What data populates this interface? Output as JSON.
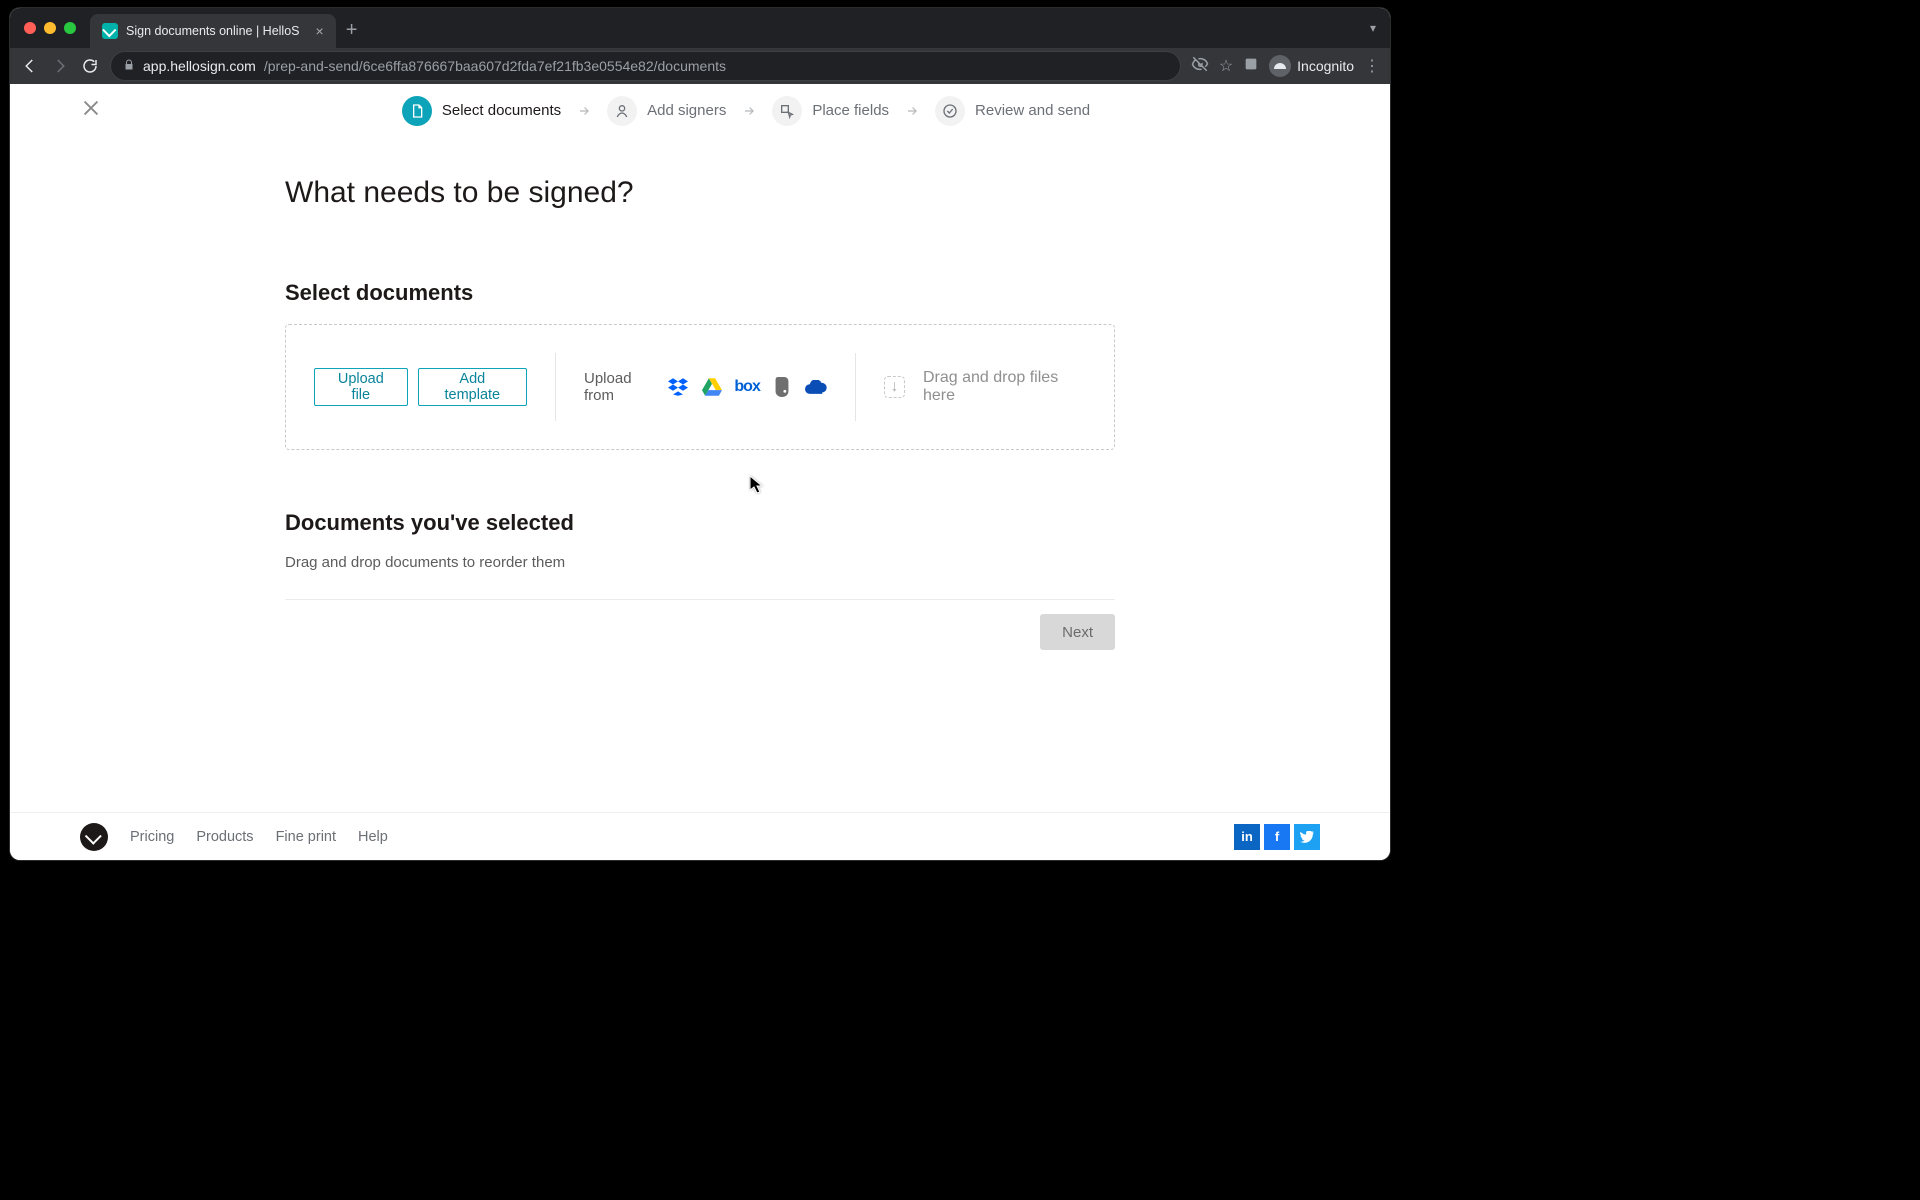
{
  "browser": {
    "tab_title": "Sign documents online | HelloS",
    "url_host": "app.hellosign.com",
    "url_path": "/prep-and-send/6ce6ffa876667baa607d2fda7ef21fb3e0554e82/documents",
    "incognito_label": "Incognito"
  },
  "steps": [
    {
      "label": "Select documents",
      "active": true
    },
    {
      "label": "Add signers",
      "active": false
    },
    {
      "label": "Place fields",
      "active": false
    },
    {
      "label": "Review and send",
      "active": false
    }
  ],
  "page": {
    "title": "What needs to be signed?",
    "section_select_label": "Select documents",
    "upload_file_btn": "Upload file",
    "add_template_btn": "Add template",
    "upload_from_label": "Upload from",
    "drag_drop_label": "Drag and drop files here",
    "selected_heading": "Documents you've selected",
    "selected_hint": "Drag and drop documents to reorder them",
    "next_btn": "Next"
  },
  "footer": {
    "links": [
      "Pricing",
      "Products",
      "Fine print",
      "Help"
    ]
  },
  "cloud_services": [
    "dropbox",
    "google-drive",
    "box",
    "evernote",
    "onedrive"
  ]
}
